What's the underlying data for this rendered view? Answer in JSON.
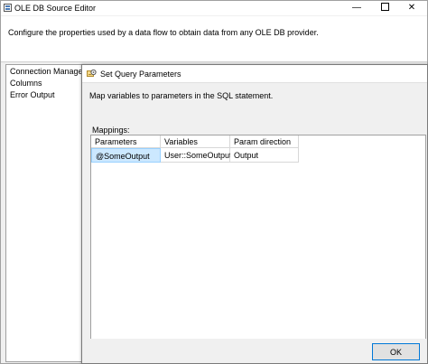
{
  "window": {
    "title": "OLE DB Source Editor",
    "minimize_glyph": "—",
    "close_glyph": "✕",
    "header_text": "Configure the properties used by a data flow to obtain data from any OLE DB provider."
  },
  "nav": {
    "items": [
      {
        "label": "Connection Manager"
      },
      {
        "label": "Columns"
      },
      {
        "label": "Error Output"
      }
    ]
  },
  "dialog": {
    "title": "Set Query Parameters",
    "description": "Map variables to parameters in the SQL statement.",
    "mappings_label": "Mappings:",
    "columns": [
      "Parameters",
      "Variables",
      "Param direction"
    ],
    "rows": [
      {
        "parameter": "@SomeOutput",
        "variable": "User::SomeOutput",
        "direction": "Output"
      }
    ],
    "ok_label": "OK"
  },
  "icons": {
    "app": "database-source-icon",
    "dialog": "parameters-icon"
  },
  "colors": {
    "selection": "#cce8ff",
    "button_focus_border": "#0078d7"
  }
}
